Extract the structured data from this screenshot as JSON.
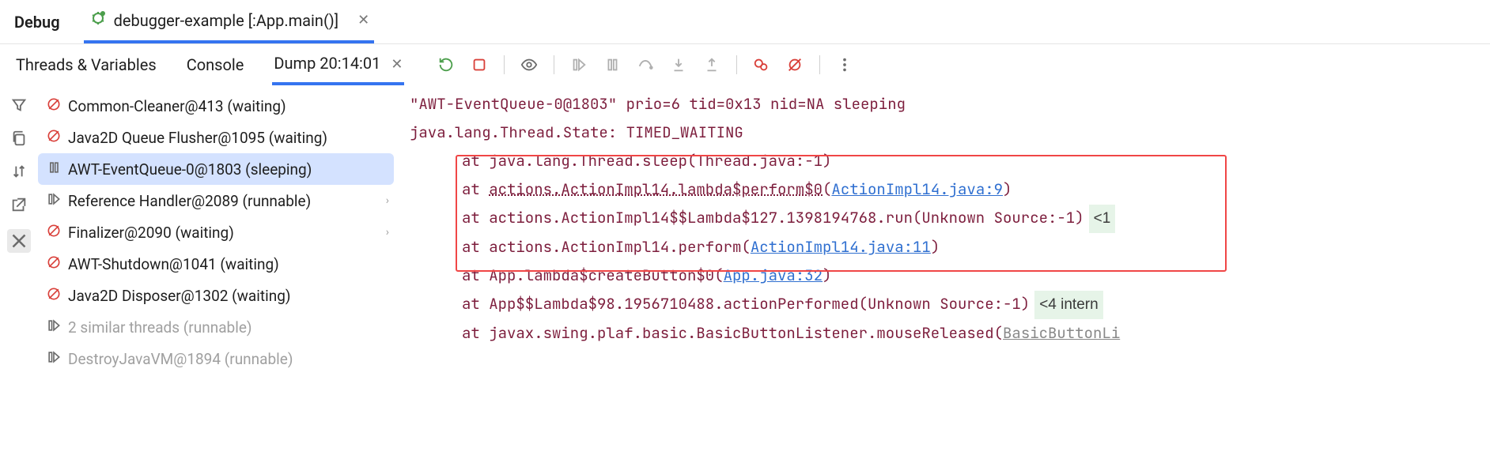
{
  "top": {
    "debug_label": "Debug",
    "run_tab": "debugger-example [:App.main()]"
  },
  "sub_tabs": {
    "threads": "Threads & Variables",
    "console": "Console",
    "dump": "Dump 20:14:01"
  },
  "threads": [
    {
      "icon": "waiting",
      "label": "Common-Cleaner@413 (waiting)",
      "dim": false,
      "chev": false
    },
    {
      "icon": "waiting",
      "label": "Java2D Queue Flusher@1095 (waiting)",
      "dim": false,
      "chev": false
    },
    {
      "icon": "paused",
      "label": "AWT-EventQueue-0@1803 (sleeping)",
      "dim": false,
      "chev": false,
      "selected": true
    },
    {
      "icon": "running",
      "label": "Reference Handler@2089 (runnable)",
      "dim": false,
      "chev": true
    },
    {
      "icon": "waiting",
      "label": "Finalizer@2090 (waiting)",
      "dim": false,
      "chev": true
    },
    {
      "icon": "waiting",
      "label": "AWT-Shutdown@1041 (waiting)",
      "dim": false,
      "chev": false
    },
    {
      "icon": "waiting",
      "label": "Java2D Disposer@1302 (waiting)",
      "dim": false,
      "chev": false
    },
    {
      "icon": "running",
      "label": "2 similar threads (runnable)",
      "dim": true,
      "chev": false
    },
    {
      "icon": "running",
      "label": "DestroyJavaVM@1894 (runnable)",
      "dim": true,
      "chev": false
    }
  ],
  "stack": {
    "header": "\"AWT-EventQueue-0@1803\" prio=6 tid=0x13 nid=NA sleeping",
    "state": " java.lang.Thread.State: TIMED_WAITING",
    "l1": "at java.lang.Thread.sleep(Thread.java:-1)",
    "l2_a": "at ",
    "l2_b": "actions.ActionImpl14.lambda$perform$0",
    "l2_c": "(",
    "l2_link": "ActionImpl14.java:9",
    "l2_d": ")",
    "l3": "at actions.ActionImpl14$$Lambda$127.1398194768.run(Unknown Source:-1)",
    "l3_badge": "<1",
    "l4_a": "at actions.ActionImpl14.perform(",
    "l4_link": "ActionImpl14.java:11",
    "l4_b": ")",
    "l5_a": "at App.lambda$createButton$0(",
    "l5_link": "App.java:32",
    "l5_b": ")",
    "l6": "at App$$Lambda$98.1956710488.actionPerformed(Unknown Source:-1)",
    "l6_badge": "<4 intern",
    "l7_a": "at javax.swing.plaf.basic.BasicButtonListener.mouseReleased(",
    "l7_link": "BasicButtonLi"
  }
}
